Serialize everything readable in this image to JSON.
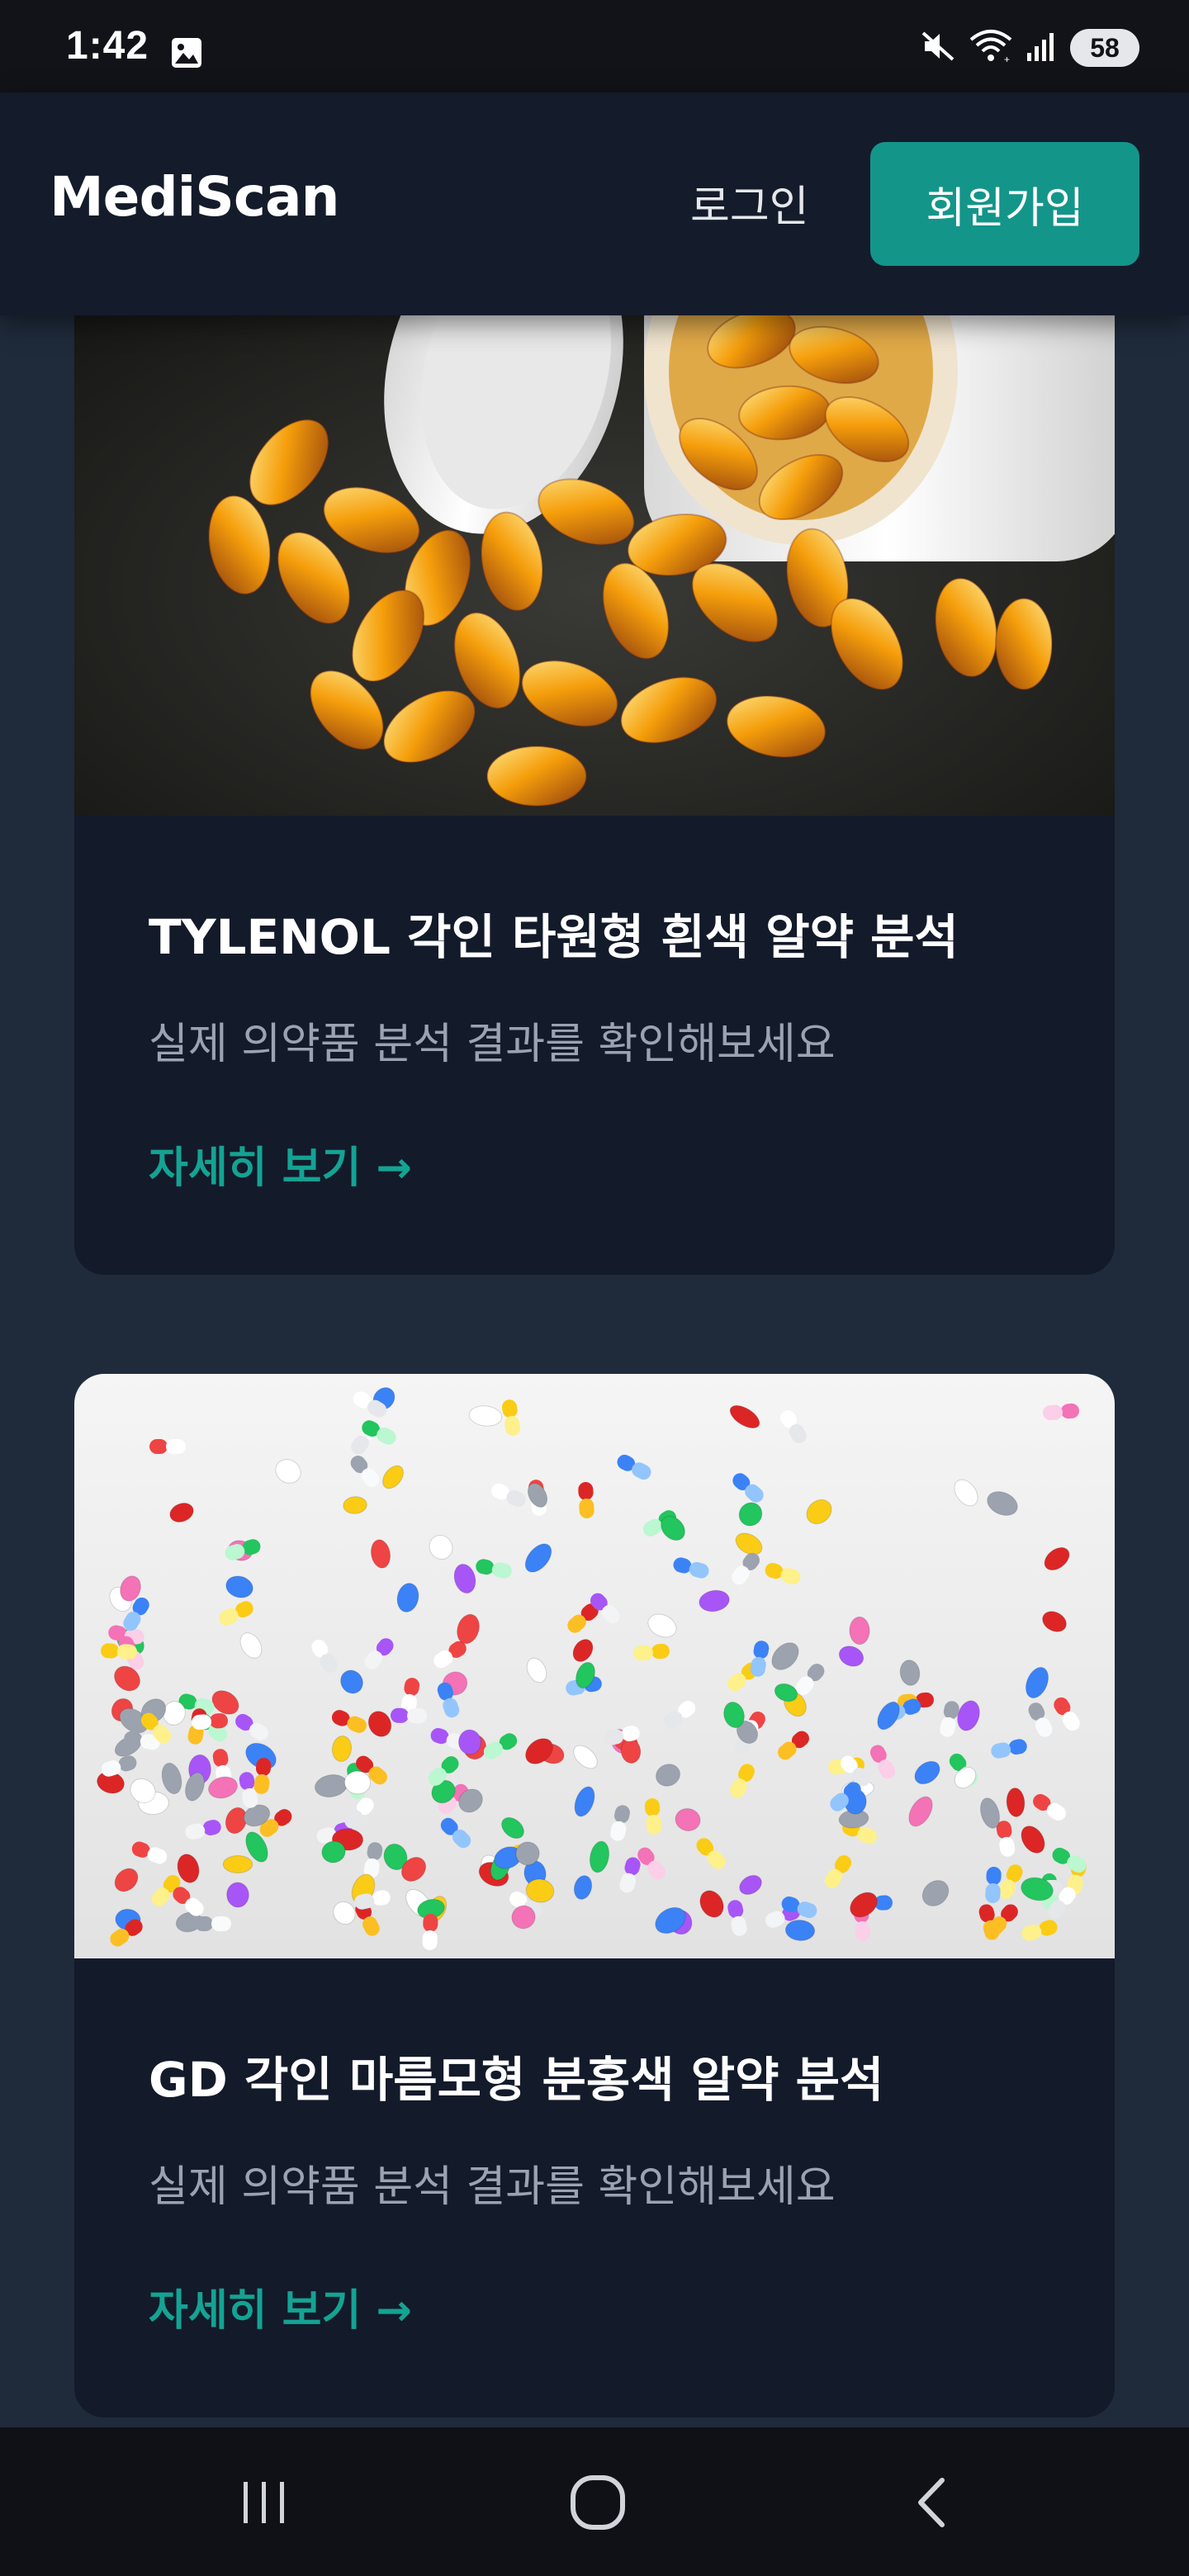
{
  "status_bar": {
    "time": "1:42",
    "battery": "58"
  },
  "header": {
    "brand": "MediScan",
    "login_label": "로그인",
    "signup_label": "회원가입"
  },
  "cards": [
    {
      "title": "TYLENOL 각인 타원형 흰색 알약 분석",
      "description": "실제 의약품 분석 결과를 확인해보세요",
      "link_label": "자세히 보기 →",
      "image_desc": "golden softgel capsules spilling from white bottle"
    },
    {
      "title": "GD 각인 마름모형 분홍색 알약 분석",
      "description": "실제 의약품 분석 결과를 확인해보세요",
      "link_label": "자세히 보기 →",
      "image_desc": "colorful assorted pills and capsules falling on white surface"
    }
  ],
  "nav": {
    "recent_icon": "recent-apps-icon",
    "home_icon": "home-icon",
    "back_icon": "back-icon"
  },
  "colors": {
    "accent": "#14958a",
    "link": "#14a393",
    "background": "#1f2a3b",
    "card": "#131a2a"
  }
}
